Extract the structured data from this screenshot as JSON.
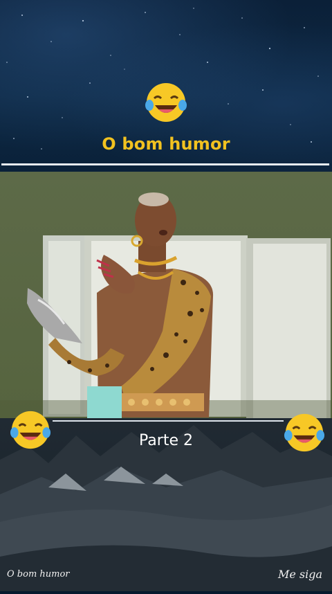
{
  "header": {
    "title": "O bom humor",
    "emoji_icon": "laughing-crying-face-icon"
  },
  "video": {
    "subject": "dancer-in-leopard-costume",
    "background_color": "#5a6843"
  },
  "section": {
    "label": "Parte 2"
  },
  "footer": {
    "left_text": "O bom humor",
    "right_text": "Me siga"
  },
  "colors": {
    "title": "#f2c220",
    "rule": "#e8eef4",
    "sky": "#0b2038",
    "mountains": "#1d262e"
  }
}
